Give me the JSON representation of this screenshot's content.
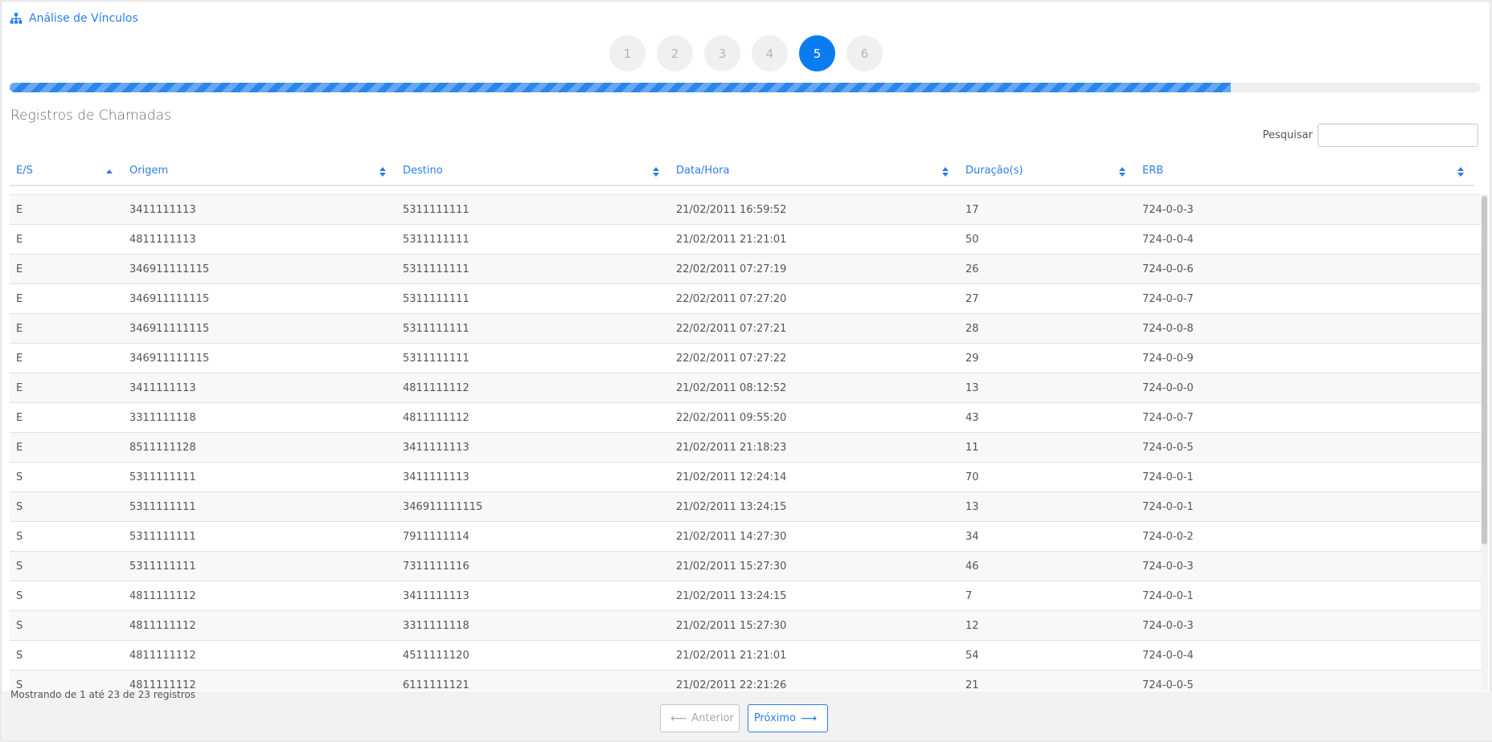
{
  "header": {
    "title": "Análise de Vínculos",
    "icon": "sitemap-icon"
  },
  "steps": [
    {
      "label": "1",
      "active": false
    },
    {
      "label": "2",
      "active": false
    },
    {
      "label": "3",
      "active": false
    },
    {
      "label": "4",
      "active": false
    },
    {
      "label": "5",
      "active": true
    },
    {
      "label": "6",
      "active": false
    }
  ],
  "progress": {
    "percent": 83
  },
  "section": {
    "title": "Registros de Chamadas"
  },
  "search": {
    "label": "Pesquisar",
    "value": ""
  },
  "table": {
    "columns": [
      "E/S",
      "Origem",
      "Destino",
      "Data/Hora",
      "Duração(s)",
      "ERB"
    ],
    "rows": [
      [
        "E",
        "3411111113",
        "5311111111",
        "21/02/2011 16:59:52",
        "17",
        "724-0-0-3"
      ],
      [
        "E",
        "4811111113",
        "5311111111",
        "21/02/2011 21:21:01",
        "50",
        "724-0-0-4"
      ],
      [
        "E",
        "346911111115",
        "5311111111",
        "22/02/2011 07:27:19",
        "26",
        "724-0-0-6"
      ],
      [
        "E",
        "346911111115",
        "5311111111",
        "22/02/2011 07:27:20",
        "27",
        "724-0-0-7"
      ],
      [
        "E",
        "346911111115",
        "5311111111",
        "22/02/2011 07:27:21",
        "28",
        "724-0-0-8"
      ],
      [
        "E",
        "346911111115",
        "5311111111",
        "22/02/2011 07:27:22",
        "29",
        "724-0-0-9"
      ],
      [
        "E",
        "3411111113",
        "4811111112",
        "21/02/2011 08:12:52",
        "13",
        "724-0-0-0"
      ],
      [
        "E",
        "3311111118",
        "4811111112",
        "22/02/2011 09:55:20",
        "43",
        "724-0-0-7"
      ],
      [
        "E",
        "8511111128",
        "3411111113",
        "21/02/2011 21:18:23",
        "11",
        "724-0-0-5"
      ],
      [
        "S",
        "5311111111",
        "3411111113",
        "21/02/2011 12:24:14",
        "70",
        "724-0-0-1"
      ],
      [
        "S",
        "5311111111",
        "346911111115",
        "21/02/2011 13:24:15",
        "13",
        "724-0-0-1"
      ],
      [
        "S",
        "5311111111",
        "7911111114",
        "21/02/2011 14:27:30",
        "34",
        "724-0-0-2"
      ],
      [
        "S",
        "5311111111",
        "7311111116",
        "21/02/2011 15:27:30",
        "46",
        "724-0-0-3"
      ],
      [
        "S",
        "4811111112",
        "3411111113",
        "21/02/2011 13:24:15",
        "7",
        "724-0-0-1"
      ],
      [
        "S",
        "4811111112",
        "3311111118",
        "21/02/2011 15:27:30",
        "12",
        "724-0-0-3"
      ],
      [
        "S",
        "4811111112",
        "4511111120",
        "21/02/2011 21:21:01",
        "54",
        "724-0-0-4"
      ],
      [
        "S",
        "4811111112",
        "6111111121",
        "21/02/2011 22:21:26",
        "21",
        "724-0-0-5"
      ]
    ]
  },
  "footer": {
    "info": "Mostrando de 1 até 23 de 23 registros",
    "prev_label": "Anterior",
    "next_label": "Próximo"
  },
  "colors": {
    "accent": "#0a7cf0",
    "link": "#2b7de9"
  }
}
